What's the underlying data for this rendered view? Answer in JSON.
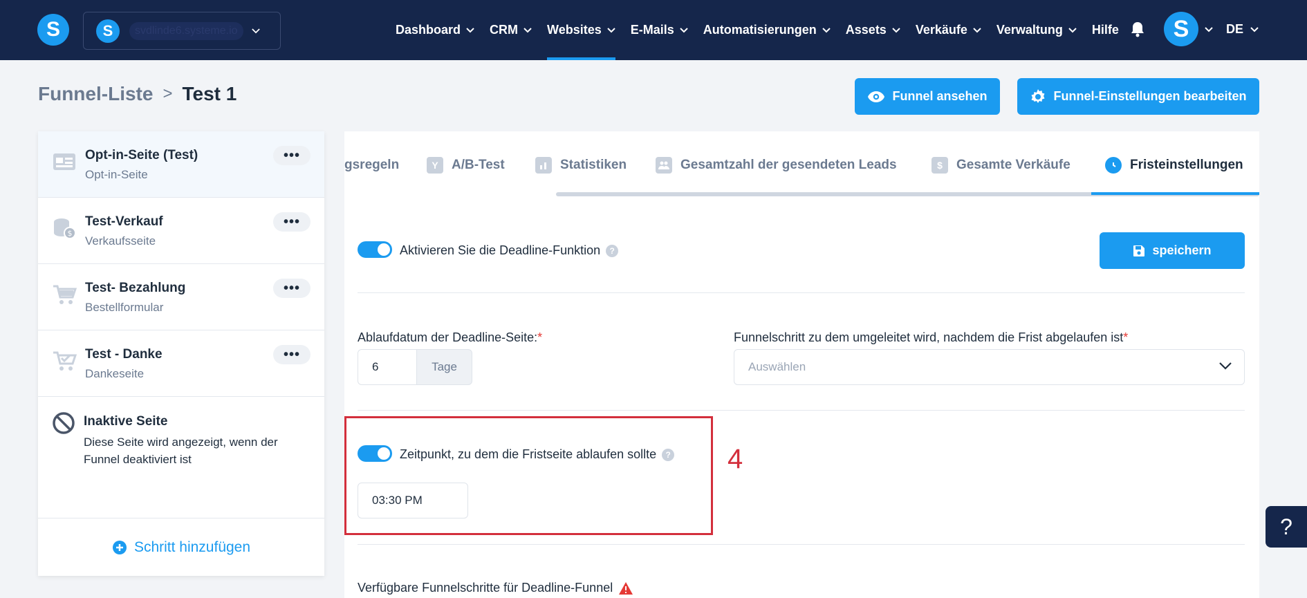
{
  "header": {
    "logo_letter": "S",
    "domain": "svdlinde6.systeme.io",
    "nav": [
      {
        "label": "Dashboard"
      },
      {
        "label": "CRM"
      },
      {
        "label": "Websites"
      },
      {
        "label": "E-Mails"
      },
      {
        "label": "Automatisierungen"
      },
      {
        "label": "Assets"
      },
      {
        "label": "Verkäufe"
      },
      {
        "label": "Verwaltung"
      },
      {
        "label": "Hilfe"
      }
    ],
    "active_nav": "Websites",
    "avatar_letter": "S",
    "language": "DE"
  },
  "breadcrumb": {
    "parent": "Funnel-Liste",
    "separator": ">",
    "current": "Test 1"
  },
  "actions": {
    "view_funnel": "Funnel ansehen",
    "edit_settings": "Funnel-Einstellungen bearbeiten"
  },
  "sidebar": {
    "steps": [
      {
        "title": "Opt-in-Seite (Test)",
        "subtitle": "Opt-in-Seite",
        "menu": "•••",
        "icon": "optin-page-icon"
      },
      {
        "title": "Test-Verkauf",
        "subtitle": "Verkaufsseite",
        "menu": "•••",
        "icon": "coins-icon"
      },
      {
        "title": "Test- Bezahlung",
        "subtitle": "Bestellformular",
        "menu": "•••",
        "icon": "cart-icon"
      },
      {
        "title": "Test - Danke",
        "subtitle": "Dankeseite",
        "menu": "•••",
        "icon": "cart-check-icon"
      }
    ],
    "inactive": {
      "title": "Inaktive Seite",
      "text": "Diese Seite wird angezeigt, wenn der Funnel deaktiviert ist"
    },
    "add_step": "Schritt hinzufügen"
  },
  "tabs": [
    {
      "label": "gsregeln",
      "icon": ""
    },
    {
      "label": "A/B-Test",
      "icon": "ab-test-icon"
    },
    {
      "label": "Statistiken",
      "icon": "stats-icon"
    },
    {
      "label": "Gesamtzahl der gesendeten Leads",
      "icon": "users-icon"
    },
    {
      "label": "Gesamte Verkäufe",
      "icon": "dollar-icon"
    },
    {
      "label": "Fristeinstellungen",
      "icon": "clock-icon"
    }
  ],
  "active_tab": "Fristeinstellungen",
  "deadline": {
    "enable_label": "Aktivieren Sie die Deadline-Funktion",
    "enabled": true,
    "save_label": "speichern",
    "expiry_label": "Ablaufdatum der Deadline-Seite:",
    "required_mark": "*",
    "expiry_value": "6",
    "expiry_unit": "Tage",
    "redirect_label": "Funnelschritt zu dem umgeleitet wird, nachdem die Frist abgelaufen ist",
    "redirect_placeholder": "Auswählen",
    "time_label": "Zeitpunkt, zu dem die Fristseite ablaufen sollte",
    "time_enabled": true,
    "time_value": "03:30 PM",
    "available_steps_label": "Verfügbare Funnelschritte für Deadline-Funnel"
  },
  "annotation": {
    "number": "4",
    "color": "#d32f3c"
  },
  "floating_help": "?",
  "colors": {
    "brand_blue": "#1b9bf0",
    "navy": "#15264b"
  }
}
